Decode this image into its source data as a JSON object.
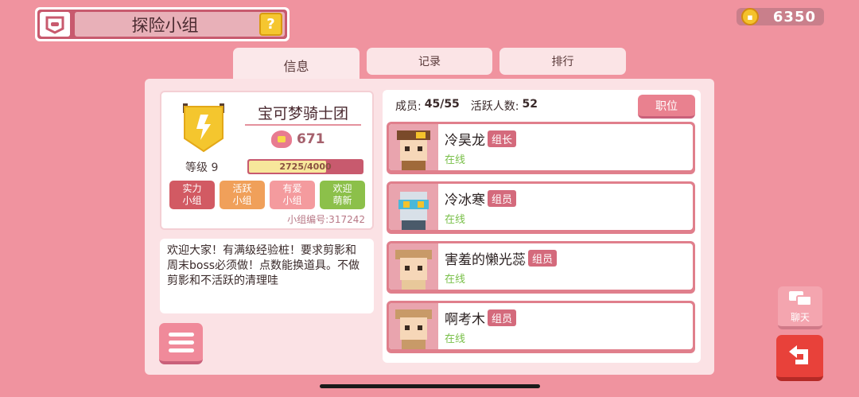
{
  "header": {
    "title": "探险小组",
    "help_label": "?"
  },
  "currency": {
    "icon": "team-coin-icon",
    "value": "6350"
  },
  "tabs": [
    {
      "label": "信息",
      "active": true
    },
    {
      "label": "记录",
      "active": false
    },
    {
      "label": "排行",
      "active": false
    }
  ],
  "group": {
    "name": "宝可梦骑士团",
    "score": "671",
    "level_label": "等级 9",
    "xp_text": "2725/4000",
    "xp_progress": 0.68,
    "tags": [
      {
        "label": "实力\n小组",
        "color": "#d25a63"
      },
      {
        "label": "活跃\n小组",
        "color": "#f0a05a"
      },
      {
        "label": "有爱\n小组",
        "color": "#f49b9e"
      },
      {
        "label": "欢迎\n萌新",
        "color": "#8cc04a"
      }
    ],
    "id_label": "小组编号:317242",
    "description": "欢迎大家！有满级经验桩！要求剪影和周末boss必须做！点数能换道具。不做剪影和不活跃的清理哇"
  },
  "members_panel": {
    "members_label": "成员:",
    "members_count": "45/55",
    "active_label": "活跃人数:",
    "active_count": "52",
    "role_button": "职位"
  },
  "members": [
    {
      "name": "冷昊龙",
      "role": "组长",
      "status": "在线"
    },
    {
      "name": "冷冰寒",
      "role": "组员",
      "status": "在线"
    },
    {
      "name": "害羞的懒光蕊",
      "role": "组员",
      "status": "在线"
    },
    {
      "name": "啊考木",
      "role": "组员",
      "status": "在线"
    }
  ],
  "chat_button": {
    "label": "聊天"
  }
}
